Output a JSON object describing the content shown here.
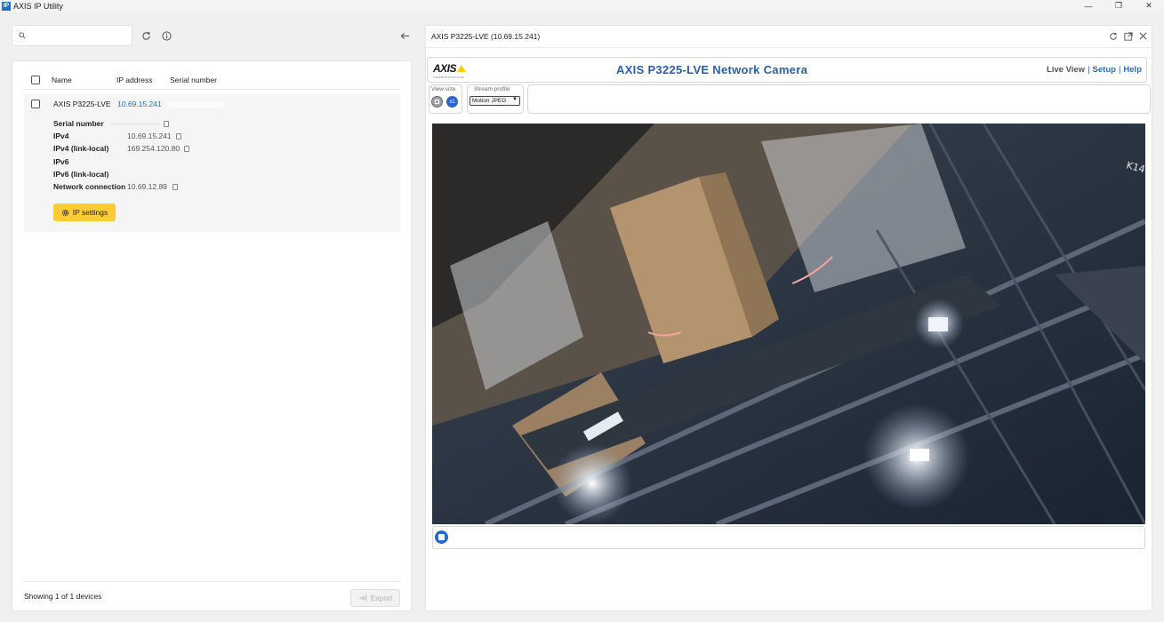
{
  "window": {
    "app_icon_text": "IP",
    "title": "AXIS IP Utility",
    "minimize": "—",
    "maximize": "❐",
    "close": "✕"
  },
  "toolbar": {
    "search_placeholder": "",
    "search_icon": "search-icon",
    "refresh_icon": "refresh-icon",
    "info_icon": "info-icon",
    "back_icon": "back-arrow-icon"
  },
  "device_list": {
    "columns": [
      "Name",
      "IP address",
      "Serial number"
    ],
    "devices": [
      {
        "name": "AXIS P3225-LVE",
        "ip": "10.69.15.241",
        "details": [
          {
            "label": "Serial number",
            "value": ""
          },
          {
            "label": "IPv4",
            "value": "10.69.15.241"
          },
          {
            "label": "IPv4 (link-local)",
            "value": "169.254.120.80"
          },
          {
            "label": "IPv6",
            "value": ""
          },
          {
            "label": "IPv6 (link-local)",
            "value": ""
          },
          {
            "label": "Network connection",
            "value": "10.69.12.89"
          }
        ],
        "ip_settings_label": "IP settings"
      }
    ],
    "footer_text": "Showing 1 of 1 devices",
    "export_label": "Export"
  },
  "camera_panel": {
    "tab_title": "AXIS P3225-LVE (10.69.15.241)",
    "header_icons": [
      "refresh-icon",
      "open-external-icon",
      "close-icon"
    ],
    "logo_text": "AXIS",
    "logo_sub": "COMMUNICATIONS",
    "camera_title": "AXIS P3225-LVE Network Camera",
    "nav": {
      "live_view": "Live View",
      "setup": "Setup",
      "help": "Help",
      "separator": "|"
    },
    "view_size_label": "View size",
    "stream_profile_label": "Stream profile",
    "stream_profile_value": "Motion JPEG",
    "view_size_options": [
      "fit-icon",
      "x1"
    ]
  },
  "colors": {
    "accent_yellow": "#ffcc33",
    "link_blue": "#1a73c8",
    "camera_title_blue": "#2b5ea7",
    "play_button_blue": "#2a66d0"
  }
}
